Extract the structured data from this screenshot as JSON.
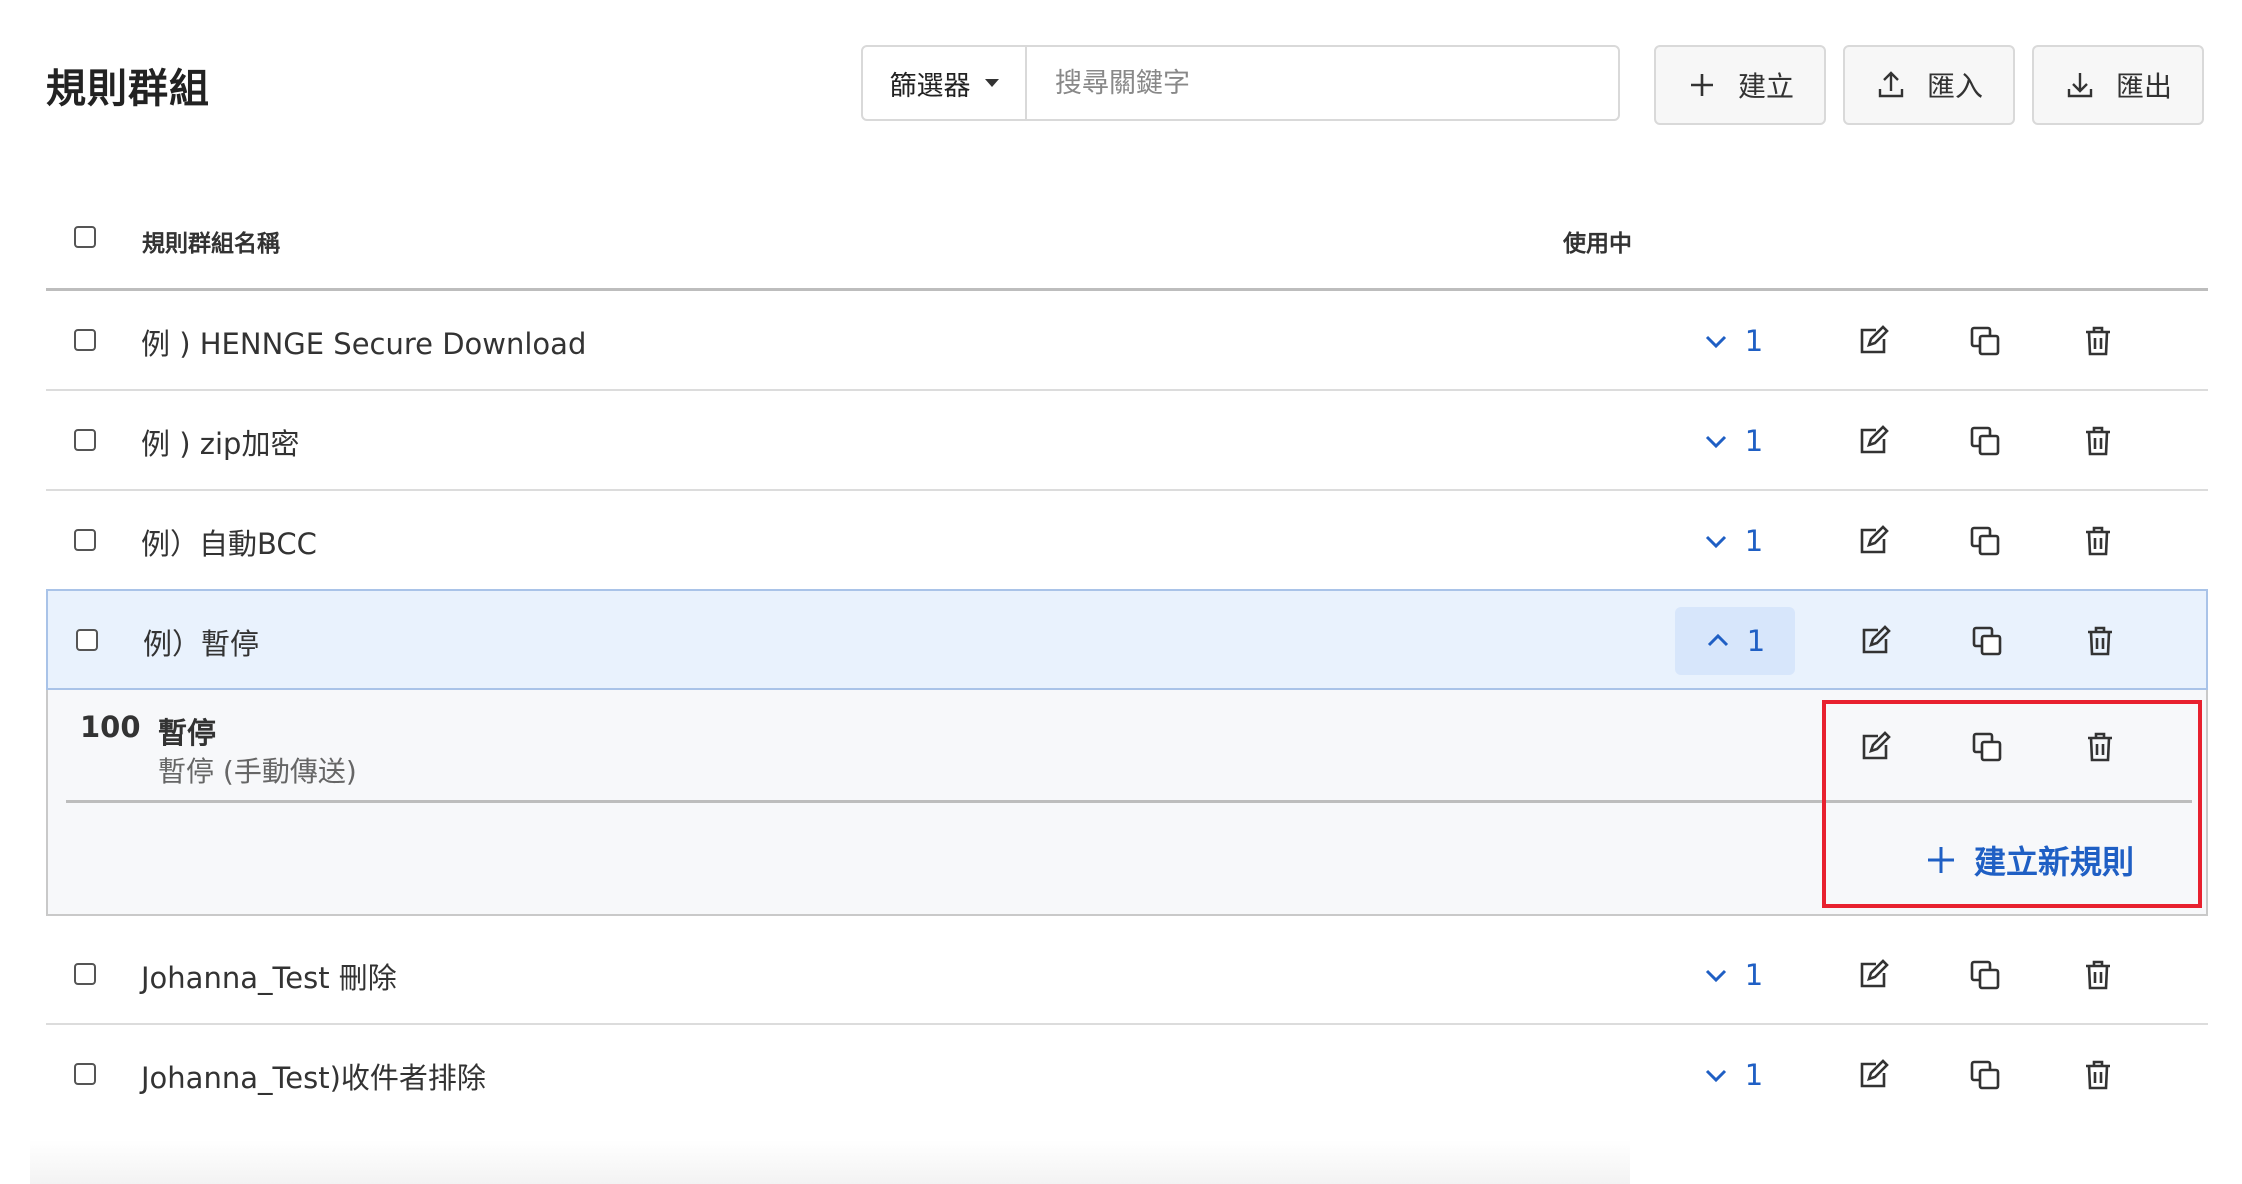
{
  "page_title": "規則群組",
  "filter": {
    "label": "篩選器"
  },
  "search": {
    "placeholder": "搜尋關鍵字"
  },
  "toolbar": {
    "create_label": "建立",
    "import_label": "匯入",
    "export_label": "匯出"
  },
  "table": {
    "headers": {
      "name": "規則群組名稱",
      "active": "使用中"
    },
    "rows": [
      {
        "name": "例 ) HENNGE Secure Download",
        "count": "1",
        "expanded": false
      },
      {
        "name": "例 ) zip加密",
        "count": "1",
        "expanded": false
      },
      {
        "name": "例）自動BCC",
        "count": "1",
        "expanded": false
      },
      {
        "name": "例）暫停",
        "count": "1",
        "expanded": true
      },
      {
        "name": "Johanna_Test 刪除",
        "count": "1",
        "expanded": false
      },
      {
        "name": "Johanna_Test)收件者排除",
        "count": "1",
        "expanded": false
      }
    ]
  },
  "expanded_rule": {
    "priority": "100",
    "title": "暫停",
    "subtitle": "暫停 (手動傳送)"
  },
  "new_rule_label": "建立新規則",
  "colors": {
    "accent": "#1f5fc4",
    "selected_row": "#e9f2fd",
    "highlight": "#e8212f"
  }
}
